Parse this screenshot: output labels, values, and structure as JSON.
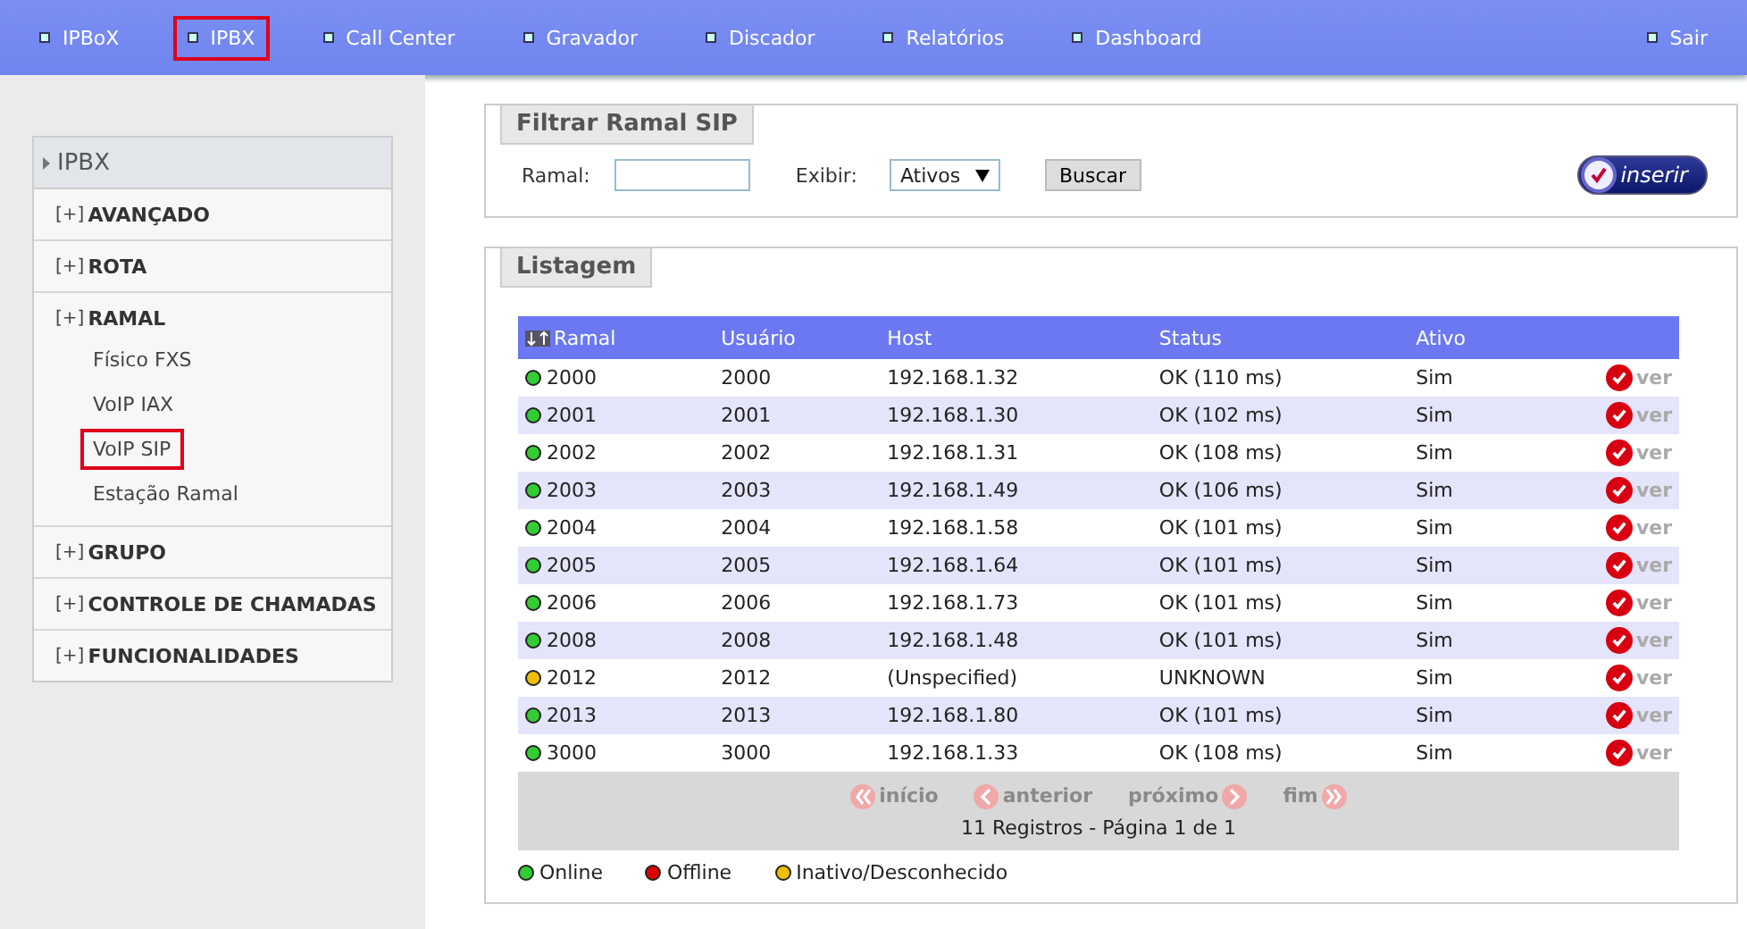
{
  "nav": {
    "items": [
      {
        "label": "IPBoX",
        "selected": false
      },
      {
        "label": "IPBX",
        "selected": true
      },
      {
        "label": "Call Center",
        "selected": false
      },
      {
        "label": "Gravador",
        "selected": false
      },
      {
        "label": "Discador",
        "selected": false
      },
      {
        "label": "Relatórios",
        "selected": false
      },
      {
        "label": "Dashboard",
        "selected": false
      }
    ],
    "exit": "Sair"
  },
  "sidebar": {
    "title": "IPBX",
    "sections": [
      {
        "toggle": "[+]",
        "label": "AVANÇADO"
      },
      {
        "toggle": "[+]",
        "label": "ROTA"
      },
      {
        "toggle": "[+]",
        "label": "RAMAL",
        "children": [
          {
            "label": "Físico FXS",
            "selected": false
          },
          {
            "label": "VoIP IAX",
            "selected": false
          },
          {
            "label": "VoIP SIP",
            "selected": true
          },
          {
            "label": "Estação Ramal",
            "selected": false
          }
        ]
      },
      {
        "toggle": "[+]",
        "label": "GRUPO"
      },
      {
        "toggle": "[+]",
        "label": "CONTROLE DE CHAMADAS"
      },
      {
        "toggle": "[+]",
        "label": "FUNCIONALIDADES"
      }
    ]
  },
  "filter": {
    "title": "Filtrar Ramal SIP",
    "ramal_label": "Ramal:",
    "show_label": "Exibir:",
    "show_value": "Ativos",
    "search_button": "Buscar",
    "insert_button": "inserir"
  },
  "listing": {
    "title": "Listagem",
    "columns": [
      "Ramal",
      "Usuário",
      "Host",
      "Status",
      "Ativo"
    ],
    "rows": [
      {
        "ramal": "2000",
        "user": "2000",
        "host": "192.168.1.32",
        "status": "OK (110 ms)",
        "active": "Sim",
        "color": "#33cc33",
        "action": "ver"
      },
      {
        "ramal": "2001",
        "user": "2001",
        "host": "192.168.1.30",
        "status": "OK (102 ms)",
        "active": "Sim",
        "color": "#33cc33",
        "action": "ver"
      },
      {
        "ramal": "2002",
        "user": "2002",
        "host": "192.168.1.31",
        "status": "OK (108 ms)",
        "active": "Sim",
        "color": "#33cc33",
        "action": "ver"
      },
      {
        "ramal": "2003",
        "user": "2003",
        "host": "192.168.1.49",
        "status": "OK (106 ms)",
        "active": "Sim",
        "color": "#33cc33",
        "action": "ver"
      },
      {
        "ramal": "2004",
        "user": "2004",
        "host": "192.168.1.58",
        "status": "OK (101 ms)",
        "active": "Sim",
        "color": "#33cc33",
        "action": "ver"
      },
      {
        "ramal": "2005",
        "user": "2005",
        "host": "192.168.1.64",
        "status": "OK (101 ms)",
        "active": "Sim",
        "color": "#33cc33",
        "action": "ver"
      },
      {
        "ramal": "2006",
        "user": "2006",
        "host": "192.168.1.73",
        "status": "OK (101 ms)",
        "active": "Sim",
        "color": "#33cc33",
        "action": "ver"
      },
      {
        "ramal": "2008",
        "user": "2008",
        "host": "192.168.1.48",
        "status": "OK (101 ms)",
        "active": "Sim",
        "color": "#33cc33",
        "action": "ver"
      },
      {
        "ramal": "2012",
        "user": "2012",
        "host": "(Unspecified)",
        "status": "UNKNOWN",
        "active": "Sim",
        "color": "#f0c000",
        "action": "ver"
      },
      {
        "ramal": "2013",
        "user": "2013",
        "host": "192.168.1.80",
        "status": "OK (101 ms)",
        "active": "Sim",
        "color": "#33cc33",
        "action": "ver"
      },
      {
        "ramal": "3000",
        "user": "3000",
        "host": "192.168.1.33",
        "status": "OK (108 ms)",
        "active": "Sim",
        "color": "#33cc33",
        "action": "ver"
      }
    ],
    "pager": [
      {
        "kind": "first",
        "label": "início",
        "disabled": true
      },
      {
        "kind": "prev",
        "label": "anterior",
        "disabled": true
      },
      {
        "kind": "next",
        "label": "próximo",
        "disabled": true
      },
      {
        "kind": "last",
        "label": "fim",
        "disabled": true
      }
    ],
    "summary": "11 Registros - Página 1 de 1",
    "legend": [
      {
        "label": "Online",
        "color": "#33cc33"
      },
      {
        "label": "Offline",
        "color": "#dd0000"
      },
      {
        "label": "Inativo/Desconhecido",
        "color": "#f0c000"
      }
    ]
  }
}
